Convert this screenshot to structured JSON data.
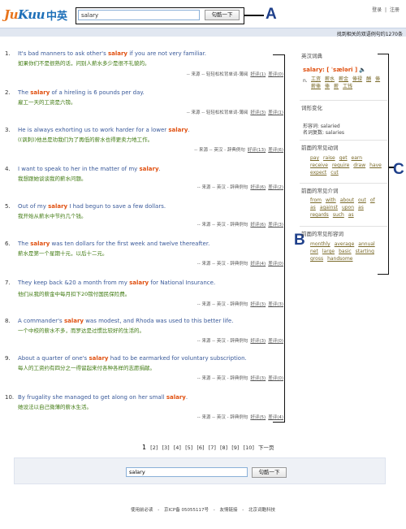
{
  "header": {
    "logo_en_a": "Ju",
    "logo_en_b": "Kuu",
    "logo_cn": "中英",
    "search_value": "salary",
    "search_button": "句酷一下",
    "links": [
      "登录",
      "|",
      "注册"
    ]
  },
  "callouts": {
    "a": "A",
    "b": "B",
    "c": "C"
  },
  "results_bar": {
    "text": "找到相关的双语例句约1270条"
  },
  "results": [
    {
      "num": "1.",
      "en_pre": "It's bad manners to ask other's ",
      "kw": "salary",
      "en_post": " if you are not very familiar.",
      "cn": "如果你们不是很熟的话，问别人薪水多少是很不礼貌的。",
      "meta": "-- 来源 -- 轻轻松松背单词-薄阅",
      "fav": "好评(1)",
      "bad": "差评(0)"
    },
    {
      "num": "2.",
      "en_pre": "The ",
      "kw": "salary",
      "en_post": " of a hireling is 6 pounds per day.",
      "cn": "雇工一天的工资是六镑。",
      "meta": "-- 来源 -- 轻轻松松背单词-薄阅",
      "fav": "好评(3)",
      "bad": "差评(1)"
    },
    {
      "num": "3.",
      "en_pre": "He is always exhorting us to work harder for a lower ",
      "kw": "salary",
      "en_post": ".",
      "cn": "((讽刺))他总是劝我们为了再低的薪水也得更卖力地工作。",
      "meta": "-- 来源 -- 英汉 - 辞典例句",
      "fav": "好评(13)",
      "bad": "差评(6)"
    },
    {
      "num": "4.",
      "en_pre": "I want to speak to her in the matter of my ",
      "kw": "salary",
      "en_post": ".",
      "cn": "我想跟她谈谈我的薪水问题。",
      "meta": "-- 来源 -- 英汉 - 辞典例句",
      "fav": "好评(6)",
      "bad": "差评(2)"
    },
    {
      "num": "5.",
      "en_pre": "Out of my ",
      "kw": "salary",
      "en_post": " I had begun to save a few dollars.",
      "cn": "我开始从薪水中节约几个钱。",
      "meta": "-- 来源 -- 英汉 - 辞典例句",
      "fav": "好评(6)",
      "bad": "差评(3)"
    },
    {
      "num": "6.",
      "en_pre": "The ",
      "kw": "salary",
      "en_post": " was ten dollars for the first week and twelve thereafter.",
      "cn": "薪水是第一个星期十元，以后十二元。",
      "meta": "-- 来源 -- 英汉 - 辞典例句",
      "fav": "好评(4)",
      "bad": "差评(0)"
    },
    {
      "num": "7.",
      "en_pre": "They keep back &20 a month from my ",
      "kw": "salary",
      "en_post": " for National Insurance.",
      "cn": "他们从我的薪金中每月扣下20镑付国民保险费。",
      "meta": "-- 来源 -- 英汉 - 辞典例句",
      "fav": "好评(3)",
      "bad": "差评(3)"
    },
    {
      "num": "8.",
      "en_pre": "A commander's ",
      "kw": "salary",
      "en_post": " was modest, and Rhoda was used to this better life.",
      "cn": "一个中校的薪水不多，而罗达是过惯比较好的生活的。",
      "meta": "-- 来源 -- 英汉 - 辞典例句",
      "fav": "好评(3)",
      "bad": "差评(0)"
    },
    {
      "num": "9.",
      "en_pre": "About a quarter of one's ",
      "kw": "salary",
      "en_post": " had to be earmarked for voluntary subscription.",
      "cn": "每人的工资约有四分之一得留起来付各种各样的志愿捐献。",
      "meta": "-- 来源 -- 英汉 - 辞典例句",
      "fav": "好评(3)",
      "bad": "差评(0)"
    },
    {
      "num": "10.",
      "en_pre": "By frugality she managed to get along on her small ",
      "kw": "salary",
      "en_post": ".",
      "cn": "她设法以自己微薄的薪水生活。",
      "meta": "-- 来源 -- 英汉 - 辞典例句",
      "fav": "好评(5)",
      "bad": "差评(4)"
    }
  ],
  "pager": {
    "current": "1",
    "pages": [
      "[2]",
      "[3]",
      "[4]",
      "[5]",
      "[6]",
      "[7]",
      "[8]",
      "[9]",
      "[10]"
    ],
    "next": "下一页"
  },
  "sidebar": {
    "dict_title": "英汉词典",
    "dict_head": "salary: [ ˈsæləri ]",
    "dict_pos": "n.",
    "dict_words": [
      "工资",
      "薪水",
      "薪金",
      "俸禄",
      "酬",
      "俸",
      "薪俸",
      "俸",
      "薪",
      "工钱"
    ],
    "forms_title": "词形变化",
    "forms_line1": "形容词: salaried",
    "forms_line2": "名词复数: salaries",
    "verbs_title": "前面的常见动词",
    "verbs": [
      "pay",
      "raise",
      "get",
      "earn",
      "receive",
      "require",
      "draw",
      "have",
      "expect",
      "cut"
    ],
    "preps_title": "前面的常见介词",
    "preps": [
      "from",
      "with",
      "about",
      "out",
      "of",
      "as",
      "against",
      "upon",
      "as",
      "regards",
      "such",
      "as"
    ],
    "adjs_title": "前面的常见形容词",
    "adjs": [
      "monthly",
      "average",
      "annual",
      "net",
      "large",
      "basic",
      "starting",
      "gross",
      "handsome"
    ]
  },
  "bottom_search": {
    "value": "salary",
    "button": "句酷一下"
  },
  "footer": [
    "使用前必读",
    "-",
    "京ICP备 05055117号",
    "-",
    "友情链接",
    "-",
    "北京词酷科技"
  ]
}
